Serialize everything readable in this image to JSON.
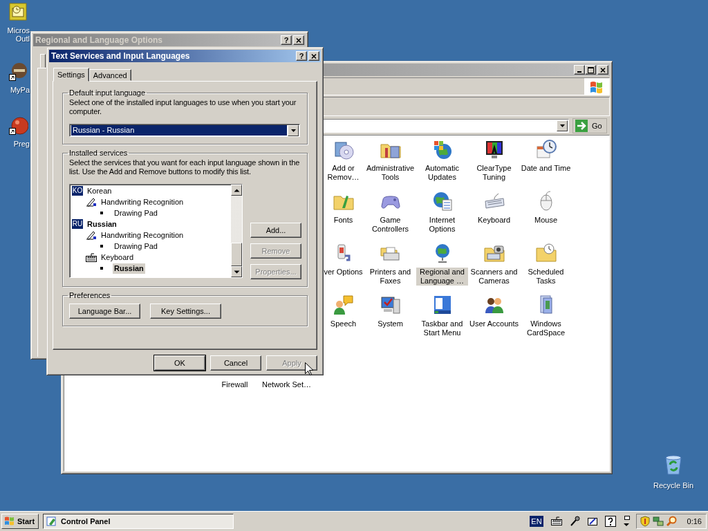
{
  "desktop_icons": [
    {
      "lines": [
        "Micros",
        "Outl"
      ]
    },
    {
      "lines": [
        "MyPa"
      ]
    },
    {
      "lines": [
        "Preg"
      ]
    }
  ],
  "recycle_bin": {
    "label": "Recycle Bin"
  },
  "control_panel": {
    "go_button": "Go",
    "rows": [
      {
        "items": [
          {
            "label": "Add or Remov…",
            "selected": false
          },
          {
            "label": "Administrative Tools",
            "selected": false
          },
          {
            "label": "Automatic Updates",
            "selected": false
          },
          {
            "label": "ClearType Tuning",
            "selected": false
          },
          {
            "label": "Date and Time",
            "selected": false
          }
        ]
      },
      {
        "items": [
          {
            "label": "Fonts",
            "selected": false
          },
          {
            "label": "Game Controllers",
            "selected": false
          },
          {
            "label": "Internet Options",
            "selected": false
          },
          {
            "label": "Keyboard",
            "selected": false
          },
          {
            "label": "Mouse",
            "selected": false
          }
        ]
      },
      {
        "items": [
          {
            "label": "ver Options",
            "selected": false
          },
          {
            "label": "Printers and Faxes",
            "selected": false
          },
          {
            "label": "Regional and Language …",
            "selected": true
          },
          {
            "label": "Scanners and Cameras",
            "selected": false
          },
          {
            "label": "Scheduled Tasks",
            "selected": false
          }
        ]
      },
      {
        "items": [
          {
            "label": "Speech",
            "selected": false
          },
          {
            "label": "System",
            "selected": false
          },
          {
            "label": "Taskbar and Start Menu",
            "selected": false
          },
          {
            "label": "User Accounts",
            "selected": false
          },
          {
            "label": "Windows CardSpace",
            "selected": false
          }
        ]
      },
      {
        "items": [
          {
            "label": "Firewall",
            "selected": false
          },
          {
            "label": "Network Set…",
            "selected": false
          }
        ]
      }
    ]
  },
  "back_window": {
    "title": "Regional and Language Options",
    "help_button": "?"
  },
  "dialog": {
    "title": "Text Services and Input Languages",
    "help_button": "?",
    "tabs": [
      {
        "label": "Settings",
        "selected": true
      },
      {
        "label": "Advanced",
        "selected": false
      }
    ],
    "default_language": {
      "legend": "Default input language",
      "description": "Select one of the installed input languages to use when you start your computer.",
      "value": "Russian - Russian"
    },
    "installed_services": {
      "legend": "Installed services",
      "description": "Select the services that you want for each input language shown in the list. Use the Add and Remove buttons to modify this list.",
      "tree": [
        {
          "kind": "language",
          "code": "KO",
          "label": "Korean",
          "default": false,
          "selected": false,
          "children": [
            {
              "kind": "pen_service",
              "label": "Handwriting Recognition",
              "default": false,
              "selected": false,
              "children": [
                {
                  "kind": "entry",
                  "label": "Drawing Pad",
                  "default": false,
                  "selected": false
                }
              ]
            }
          ]
        },
        {
          "kind": "language",
          "code": "RU",
          "label": "Russian",
          "default": true,
          "selected": false,
          "children": [
            {
              "kind": "pen_service",
              "label": "Handwriting Recognition",
              "default": false,
              "selected": false,
              "children": [
                {
                  "kind": "entry",
                  "label": "Drawing Pad",
                  "default": false,
                  "selected": false
                }
              ]
            },
            {
              "kind": "keyboard_service",
              "label": "Keyboard",
              "default": false,
              "selected": false,
              "children": [
                {
                  "kind": "entry",
                  "label": "Russian",
                  "default": true,
                  "selected": true
                }
              ]
            }
          ]
        }
      ],
      "buttons": [
        {
          "label": "Add...",
          "disabled": false
        },
        {
          "label": "Remove",
          "disabled": true
        },
        {
          "label": "Properties...",
          "disabled": true
        }
      ]
    },
    "preferences": {
      "legend": "Preferences",
      "buttons": [
        {
          "label": "Language Bar..."
        },
        {
          "label": "Key Settings..."
        }
      ]
    },
    "buttons": [
      {
        "label": "OK",
        "default": true,
        "disabled": false
      },
      {
        "label": "Cancel",
        "default": false,
        "disabled": false
      },
      {
        "label": "Apply",
        "default": false,
        "disabled": true
      }
    ]
  },
  "taskbar": {
    "start": "Start",
    "tasks": [
      {
        "label": "Control Panel",
        "selected": true
      }
    ],
    "language": "EN",
    "clock": "0:16"
  }
}
